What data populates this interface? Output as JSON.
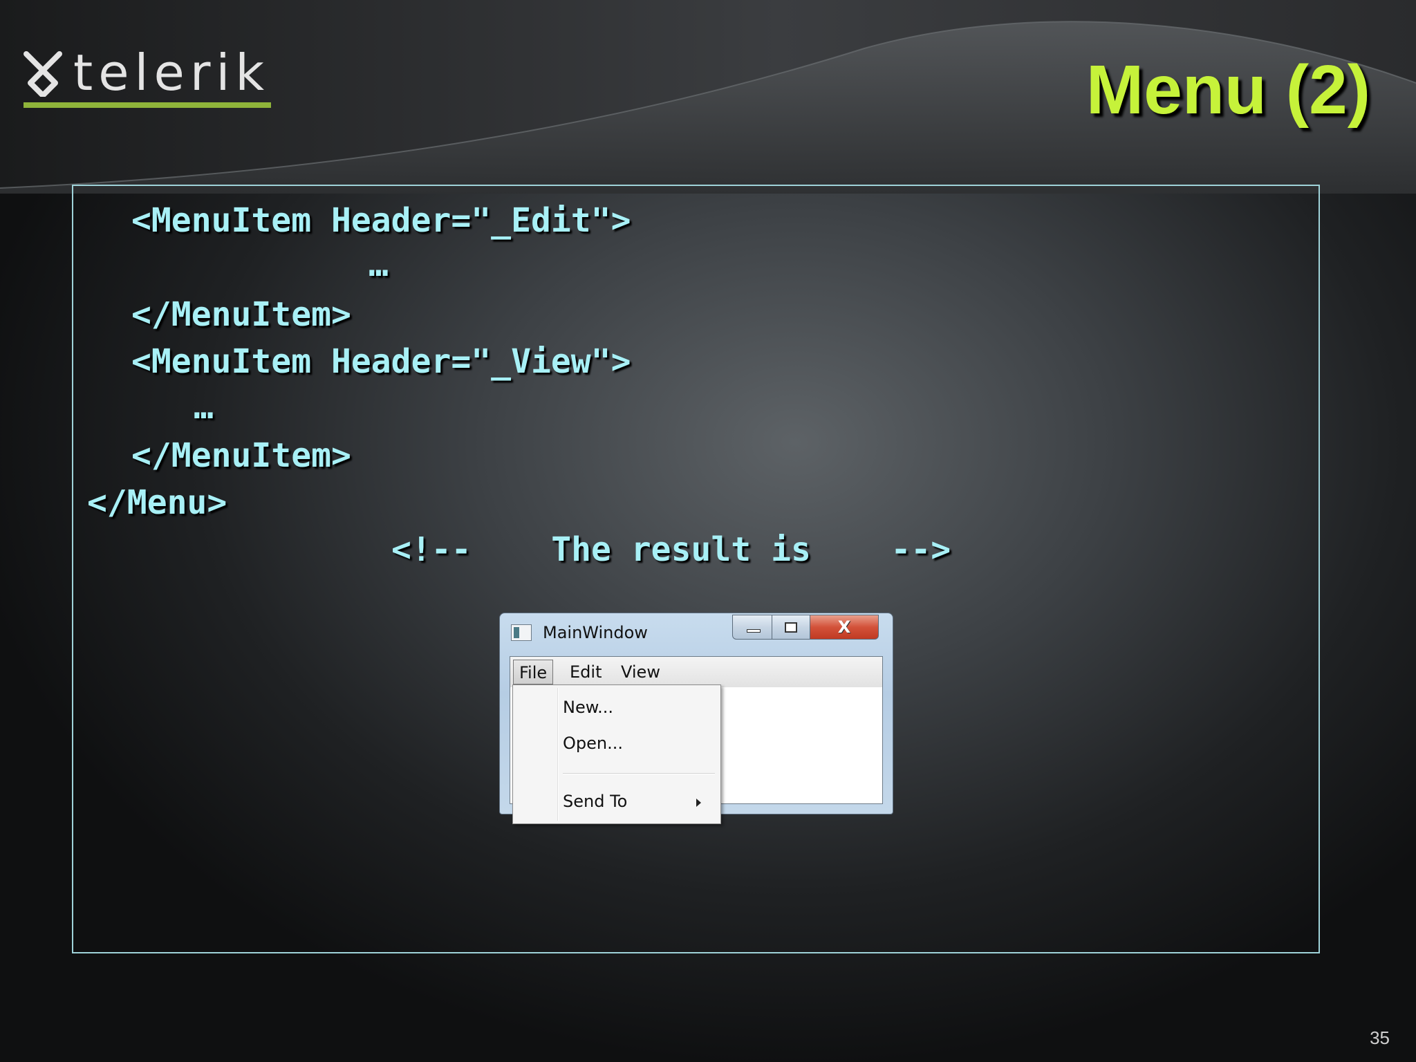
{
  "brand": {
    "logo_text": "telerik"
  },
  "slide": {
    "title": "Menu (2)",
    "page_number": "35"
  },
  "code": {
    "lines": [
      "<MenuItem Header=\"_Edit\">",
      "…",
      "</MenuItem>",
      "<MenuItem Header=\"_View\">",
      "…",
      "</MenuItem>",
      "</Menu>",
      "<!--    The result is    -->"
    ]
  },
  "window": {
    "title": "MainWindow",
    "close_glyph": "X",
    "menubar": [
      "File",
      "Edit",
      "View"
    ],
    "open_menu": "File",
    "menu_items": [
      "New...",
      "Open...",
      "Send To"
    ]
  },
  "colors": {
    "title": "#c6f23a",
    "code_text": "#a8f0f6",
    "box_border": "#9fd3d9",
    "logo_underline": "#8fb43a"
  }
}
